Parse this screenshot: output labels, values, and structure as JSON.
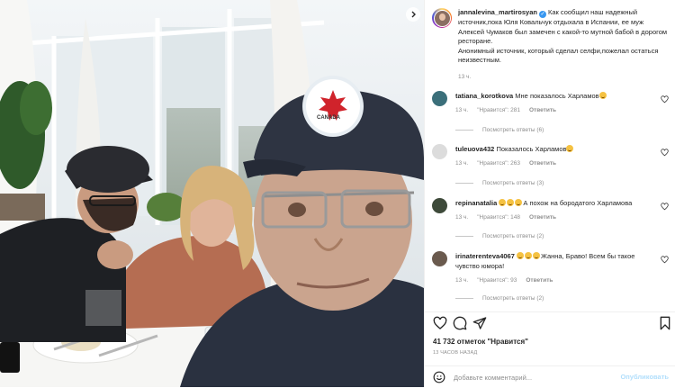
{
  "post": {
    "author": "jannalevina_martirosyan",
    "caption": "Как сообщил наш надежный источник,пока Юля Ковальчук отдыхала в Испании, ее муж Алексей Чумаков был замечен с какой-то мутной бабой в дорогом ресторане.",
    "caption_2": "Анонимный источник, который сделал селфи,пожелал остаться неизвестным.",
    "caption_time": "13 ч."
  },
  "cap_text": "CANADA",
  "comments": [
    {
      "user": "tatiana_korotkova",
      "text": "Мне показалось Харламов",
      "emojis": 1,
      "time": "13 ч.",
      "likes": "\"Нравится\": 281",
      "reply": "Ответить",
      "replies": "Посмотреть ответы (6)",
      "avatar_color": "#3b6f7a"
    },
    {
      "user": "tuleuova432",
      "text": "Показалось Харламов",
      "emojis": 1,
      "time": "13 ч.",
      "likes": "\"Нравится\": 263",
      "reply": "Ответить",
      "replies": "Посмотреть ответы (3)",
      "avatar_color": "#dcdcdc"
    },
    {
      "user": "repinanatalia",
      "pre_emojis": 3,
      "text": "А похож на бородатого Харламова",
      "time": "13 ч.",
      "likes": "\"Нравится\": 148",
      "reply": "Ответить",
      "replies": "Посмотреть ответы (2)",
      "avatar_color": "#3e4a3a"
    },
    {
      "user": "irinaterenteva4067",
      "pre_emojis": 3,
      "text": "Жанна, Браво! Всем бы такое чувство юмора!",
      "time": "13 ч.",
      "likes": "\"Нравится\": 93",
      "reply": "Ответить",
      "replies": "Посмотреть ответы (2)",
      "avatar_color": "#6a5a4e"
    }
  ],
  "actions": {
    "likes": "41 732 отметок \"Нравится\"",
    "when": "13 ЧАСОВ НАЗАД",
    "comment_placeholder": "Добавьте комментарий...",
    "publish": "Опубликовать"
  },
  "icons": {
    "like": "heart-icon",
    "comment": "comment-bubble-icon",
    "share": "paper-plane-icon",
    "save": "bookmark-icon",
    "emoji": "smile-icon",
    "next": "chevron-right-icon"
  },
  "colors": {
    "link": "#3897f0",
    "publish_disabled": "#b2dffc",
    "muted": "#8e8e8e"
  }
}
